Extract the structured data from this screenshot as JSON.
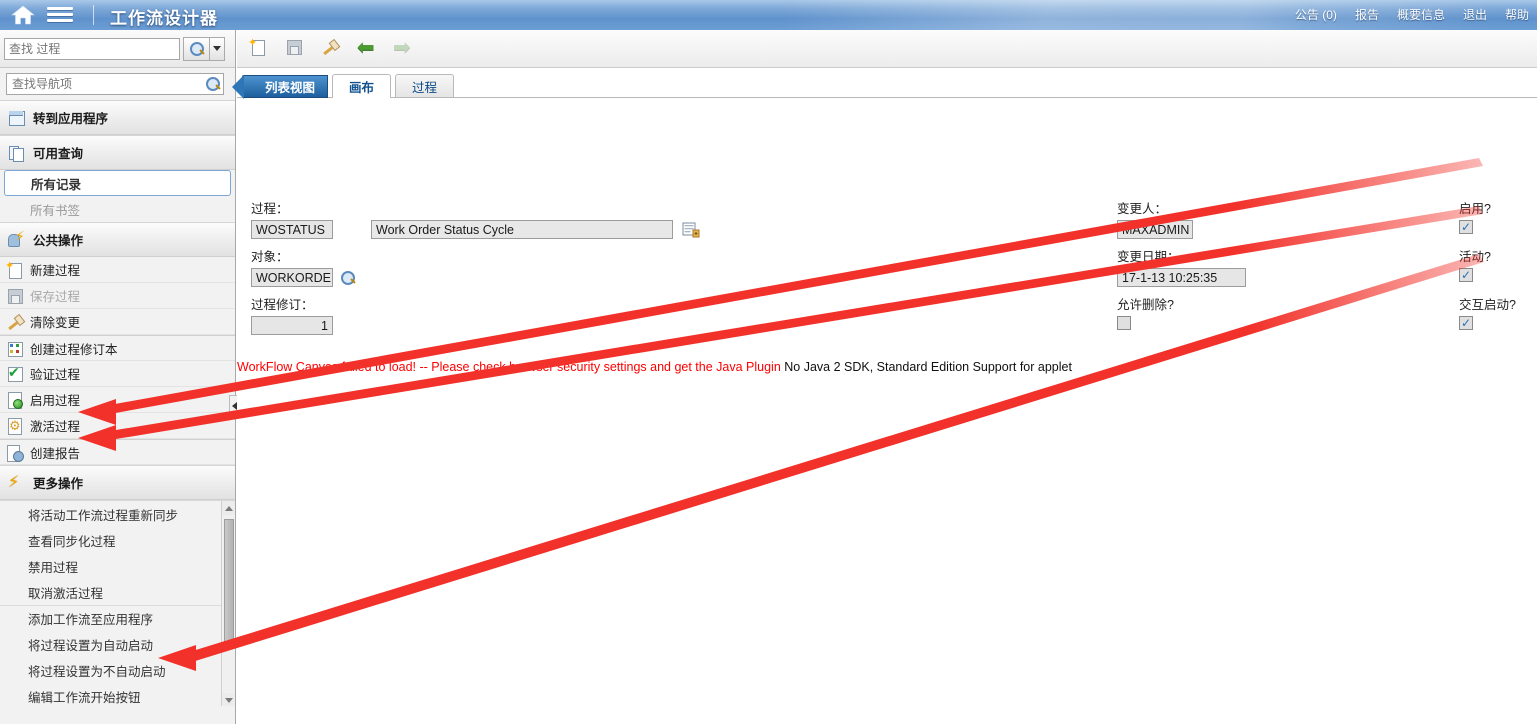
{
  "banner": {
    "title": "工作流设计器",
    "home_icon": "home-icon",
    "menu_icon": "hamburger-menu-icon",
    "nav": [
      {
        "label": "公告 (0)"
      },
      {
        "label": "报告"
      },
      {
        "label": "概要信息"
      },
      {
        "label": "退出"
      },
      {
        "label": "帮助"
      }
    ]
  },
  "sidebar": {
    "process_search": {
      "value": "",
      "placeholder": "查找 过程"
    },
    "nav_search": {
      "value": "",
      "placeholder": "查找导航项"
    },
    "goto_app": {
      "label": "转到应用程序",
      "icon": "window-icon"
    },
    "available_queries": {
      "label": "可用查询",
      "icon": "pages-icon",
      "items": [
        {
          "label": "所有记录",
          "selected": true
        },
        {
          "label": "所有书签",
          "selected": false
        }
      ]
    },
    "common_actions": {
      "label": "公共操作",
      "icon": "person-bolt-icon",
      "items": [
        {
          "label": "新建过程",
          "icon": "new-document-icon",
          "disabled": false
        },
        {
          "label": "保存过程",
          "icon": "floppy-disk-icon",
          "disabled": true
        },
        {
          "label": "清除变更",
          "icon": "brush-icon",
          "disabled": false
        },
        {
          "label": "创建过程修订本",
          "icon": "grid-colors-icon",
          "disabled": false
        },
        {
          "label": "验证过程",
          "icon": "checkmark-icon",
          "disabled": false
        },
        {
          "label": "启用过程",
          "icon": "document-green-dot-icon",
          "disabled": false
        },
        {
          "label": "激活过程",
          "icon": "document-gear-icon",
          "disabled": false
        },
        {
          "label": "创建报告",
          "icon": "document-report-icon",
          "disabled": false
        }
      ]
    },
    "more_actions": {
      "label": "更多操作",
      "icon": "bolt-icon",
      "items": [
        {
          "label": "将活动工作流过程重新同步"
        },
        {
          "label": "查看同步化过程"
        },
        {
          "label": "禁用过程"
        },
        {
          "label": "取消激活过程"
        },
        {
          "label": "添加工作流至应用程序"
        },
        {
          "label": "将过程设置为自动启动"
        },
        {
          "label": "将过程设置为不自动启动"
        },
        {
          "label": "编辑工作流开始按钮"
        }
      ]
    }
  },
  "toolbar": {
    "items": [
      {
        "name": "new-process-icon",
        "label": "新建过程",
        "disabled": false
      },
      {
        "name": "save-process-icon",
        "label": "保存过程",
        "disabled": true
      },
      {
        "name": "clear-changes-icon",
        "label": "清除变更",
        "disabled": false
      },
      {
        "name": "previous-icon",
        "label": "上一个",
        "disabled": false
      },
      {
        "name": "next-icon",
        "label": "下一个",
        "disabled": true
      }
    ]
  },
  "tabs": [
    {
      "label": "列表视图",
      "style": "arrow",
      "active": false
    },
    {
      "label": "画布",
      "style": "tab",
      "active": true
    },
    {
      "label": "过程",
      "style": "tab",
      "active": false
    }
  ],
  "form": {
    "process": {
      "label": "过程：",
      "id_value": "WOSTATUS",
      "desc_value": "Work Order Status Cycle",
      "detail_icon": "detail-menu-icon"
    },
    "object": {
      "label": "对象：",
      "value": "WORKORDE",
      "lookup_icon": "magnifier-icon"
    },
    "revision": {
      "label": "过程修订：",
      "value": "1"
    },
    "changed_by": {
      "label": "变更人：",
      "value": "MAXADMIN"
    },
    "change_date": {
      "label": "变更日期：",
      "value": "17-1-13 10:25:35"
    },
    "allow_delete": {
      "label": "允许删除?",
      "checked": false
    },
    "enabled": {
      "label": "启用?",
      "checked": true
    },
    "active": {
      "label": "活动?",
      "checked": true
    },
    "interactive_start": {
      "label": "交互启动?",
      "checked": true
    }
  },
  "error_message": {
    "red_part": "WorkFlow Canvas failed to load! -- Please check browser security settings and get the Java Plugin",
    "black_part": "No Java 2 SDK, Standard Edition Support for applet"
  },
  "colors": {
    "banner_blue": "#5f92cc",
    "accent_blue": "#1d5f9e",
    "error_red": "#ff0000",
    "annotation_red": "#f2312a",
    "sidebar_bg": "#f2f2f2",
    "field_bg": "#e6e6e6"
  },
  "annotations": {
    "arrows": [
      {
        "name": "arrow-to-enable-process"
      },
      {
        "name": "arrow-to-activate-process"
      },
      {
        "name": "arrow-to-set-auto-start"
      }
    ]
  }
}
